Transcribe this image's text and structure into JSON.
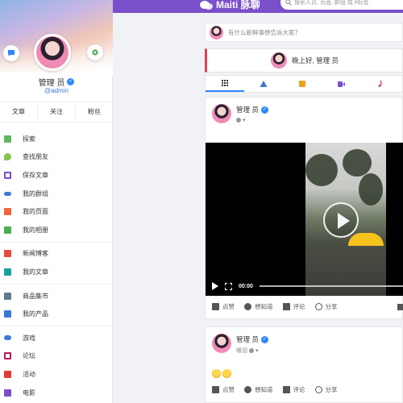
{
  "app": {
    "brand_name": "Maiti 脉聊",
    "search_placeholder": "搜索人员, 页面, 群组 或 #标签"
  },
  "profile": {
    "name": "管理 员",
    "handle": "@admin",
    "tabs": [
      "文章",
      "关注",
      "粉丝"
    ]
  },
  "menu": {
    "group1": [
      {
        "label": "探索",
        "icon": "explore-icon",
        "color": "#5cb85c"
      },
      {
        "label": "查找朋友",
        "icon": "location-icon",
        "color": "#8bc34a"
      },
      {
        "label": "保存文章",
        "icon": "bookmark-icon",
        "color": "#7b4fc9"
      },
      {
        "label": "我的群组",
        "icon": "group-icon",
        "color": "#3b7bd4"
      },
      {
        "label": "我的页面",
        "icon": "flag-icon",
        "color": "#f0643c"
      },
      {
        "label": "我的相册",
        "icon": "album-icon",
        "color": "#4caf50"
      }
    ],
    "group2": [
      {
        "label": "新闻博客",
        "icon": "blog-icon",
        "color": "#e74c3c"
      },
      {
        "label": "我的文章",
        "icon": "book-icon",
        "color": "#1a9fa0"
      }
    ],
    "group3": [
      {
        "label": "商品集市",
        "icon": "market-icon",
        "color": "#607d8b"
      },
      {
        "label": "我的产品",
        "icon": "cart-icon",
        "color": "#3b7bd4"
      }
    ],
    "group4": [
      {
        "label": "游戏",
        "icon": "gamepad-icon",
        "color": "#3b7bd4"
      },
      {
        "label": "论坛",
        "icon": "forum-icon",
        "color": "#c2185b"
      },
      {
        "label": "活动",
        "icon": "calendar-icon",
        "color": "#e53935"
      },
      {
        "label": "电影",
        "icon": "film-icon",
        "color": "#7b4fc9"
      }
    ]
  },
  "composer": {
    "placeholder": "有什么新鲜事想告诉大家？"
  },
  "greeting": {
    "text": "晚上好, 管理 员"
  },
  "toolbar": {
    "tabs": [
      {
        "icon": "grid-icon",
        "color": "#333"
      },
      {
        "icon": "text-icon",
        "color": "#3b7bd4"
      },
      {
        "icon": "image-icon",
        "color": "#f0a020"
      },
      {
        "icon": "video-icon",
        "color": "#7b4fc9"
      },
      {
        "icon": "music-icon",
        "color": "#e0405b"
      }
    ]
  },
  "posts": [
    {
      "author": "管理 员",
      "meta": "",
      "video_time": "00:00",
      "actions": [
        "点赞",
        "想知道",
        "评论",
        "分享"
      ]
    },
    {
      "author": "管理 员",
      "meta": "眼泪",
      "actions": [
        "点赞",
        "想知道",
        "评论",
        "分享"
      ]
    }
  ]
}
